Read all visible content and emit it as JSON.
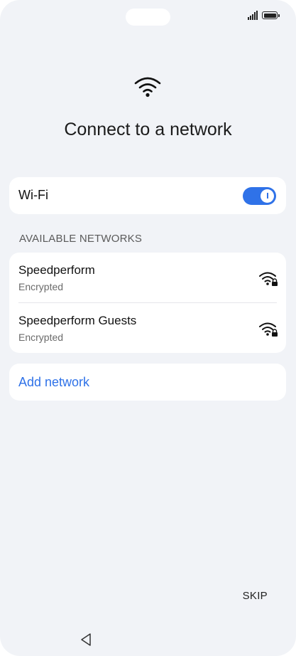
{
  "status_bar": {
    "signal_icon": "signal-bars-icon",
    "battery_icon": "battery-icon"
  },
  "header": {
    "icon": "wifi-icon",
    "title": "Connect to a network"
  },
  "wifi_toggle": {
    "label": "Wi-Fi",
    "state": "on",
    "accent_color": "#2f72e8"
  },
  "available_networks": {
    "header": "AVAILABLE NETWORKS",
    "items": [
      {
        "name": "Speedperform",
        "security": "Encrypted",
        "icon": "wifi-locked-icon"
      },
      {
        "name": "Speedperform Guests",
        "security": "Encrypted",
        "icon": "wifi-locked-icon"
      }
    ]
  },
  "add_network": {
    "label": "Add network"
  },
  "footer": {
    "skip_label": "SKIP"
  },
  "navigation": {
    "back_icon": "back-triangle-icon"
  }
}
